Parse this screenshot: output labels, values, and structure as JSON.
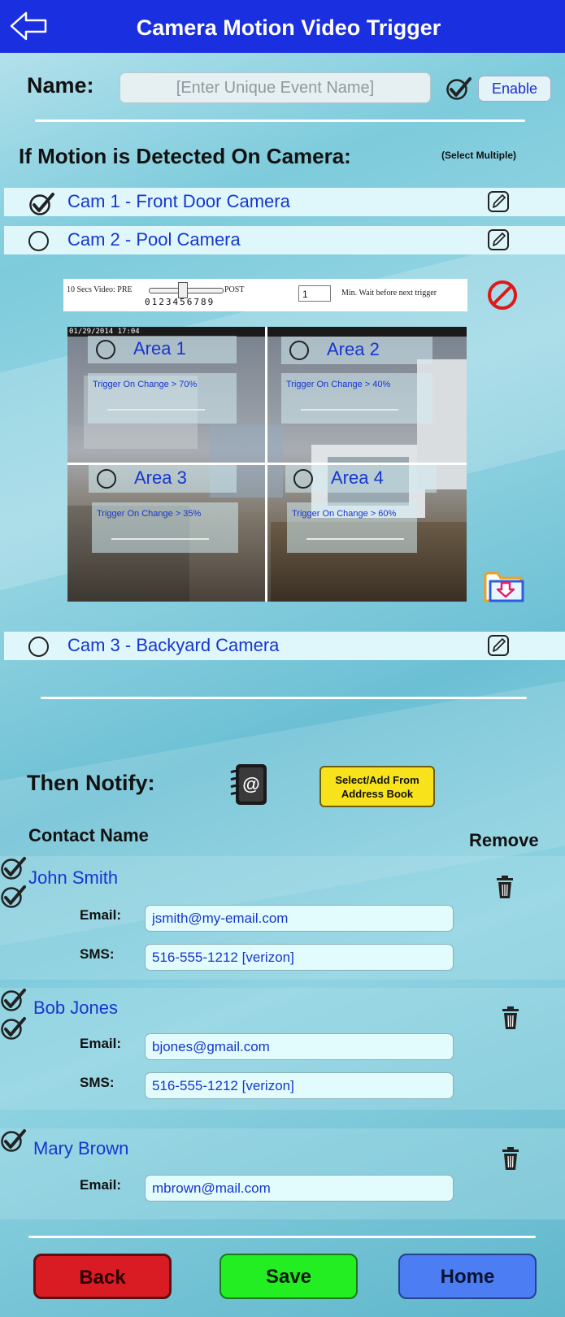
{
  "header": {
    "title": "Camera Motion Video Trigger",
    "back_icon": "left-arrow-icon",
    "color": "#1a2fe0"
  },
  "name_section": {
    "label": "Name:",
    "placeholder": "[Enter Unique Event Name]",
    "value": "",
    "enable_checked": true,
    "enable_label": "Enable"
  },
  "motion_section": {
    "heading": "If Motion is Detected On Camera:",
    "hint": "(Select Multiple)"
  },
  "cameras": [
    {
      "label": "Cam 1 - Front Door Camera",
      "checked": true,
      "edit_icon": "pencil-icon"
    },
    {
      "label": "Cam 2 - Pool Camera",
      "checked": false,
      "edit_icon": "pencil-icon"
    },
    {
      "label": "Cam 3 - Backyard Camera",
      "checked": false,
      "edit_icon": "pencil-icon"
    }
  ],
  "video_controls": {
    "pre_label": "10 Secs Video: PRE",
    "post_label": "POST",
    "digits": "0123456789",
    "wait_value": "1",
    "wait_label": "Min. Wait before next trigger",
    "cancel_icon": "no-entry-icon"
  },
  "camera_feed": {
    "timestamp": "01/29/2014 17:04",
    "areas": [
      {
        "label": "Area 1",
        "trigger": "Trigger On Change > 70%",
        "selected": false
      },
      {
        "label": "Area 2",
        "trigger": "Trigger On Change > 40%",
        "selected": false
      },
      {
        "label": "Area 3",
        "trigger": "Trigger On Change > 35%",
        "selected": false
      },
      {
        "label": "Area 4",
        "trigger": "Trigger On Change > 60%",
        "selected": false
      }
    ],
    "save_icon": "folder-download-icon"
  },
  "notify_section": {
    "heading": "Then Notify:",
    "addressbook_icon": "address-book-icon",
    "addressbook_button": {
      "line1": "Select/Add From",
      "line2": "Address Book"
    },
    "col_contact": "Contact Name",
    "col_remove": "Remove"
  },
  "contacts": [
    {
      "name": "John Smith",
      "email": {
        "label": "Email:",
        "value": "jsmith@my-email.com",
        "checked": true
      },
      "sms": {
        "label": "SMS:",
        "value": "516-555-1212 [verizon]",
        "checked": true
      }
    },
    {
      "name": "Bob Jones",
      "email": {
        "label": "Email:",
        "value": "bjones@gmail.com",
        "checked": true
      },
      "sms": {
        "label": "SMS:",
        "value": "516-555-1212 [verizon]",
        "checked": true
      }
    },
    {
      "name": "Mary Brown",
      "email": {
        "label": "Email:",
        "value": "mbrown@mail.com",
        "checked": true
      }
    }
  ],
  "footer": {
    "back": "Back",
    "save": "Save",
    "home": "Home",
    "back_color": "#d91c24",
    "save_color": "#22ee22",
    "home_color": "#4c7df2"
  }
}
